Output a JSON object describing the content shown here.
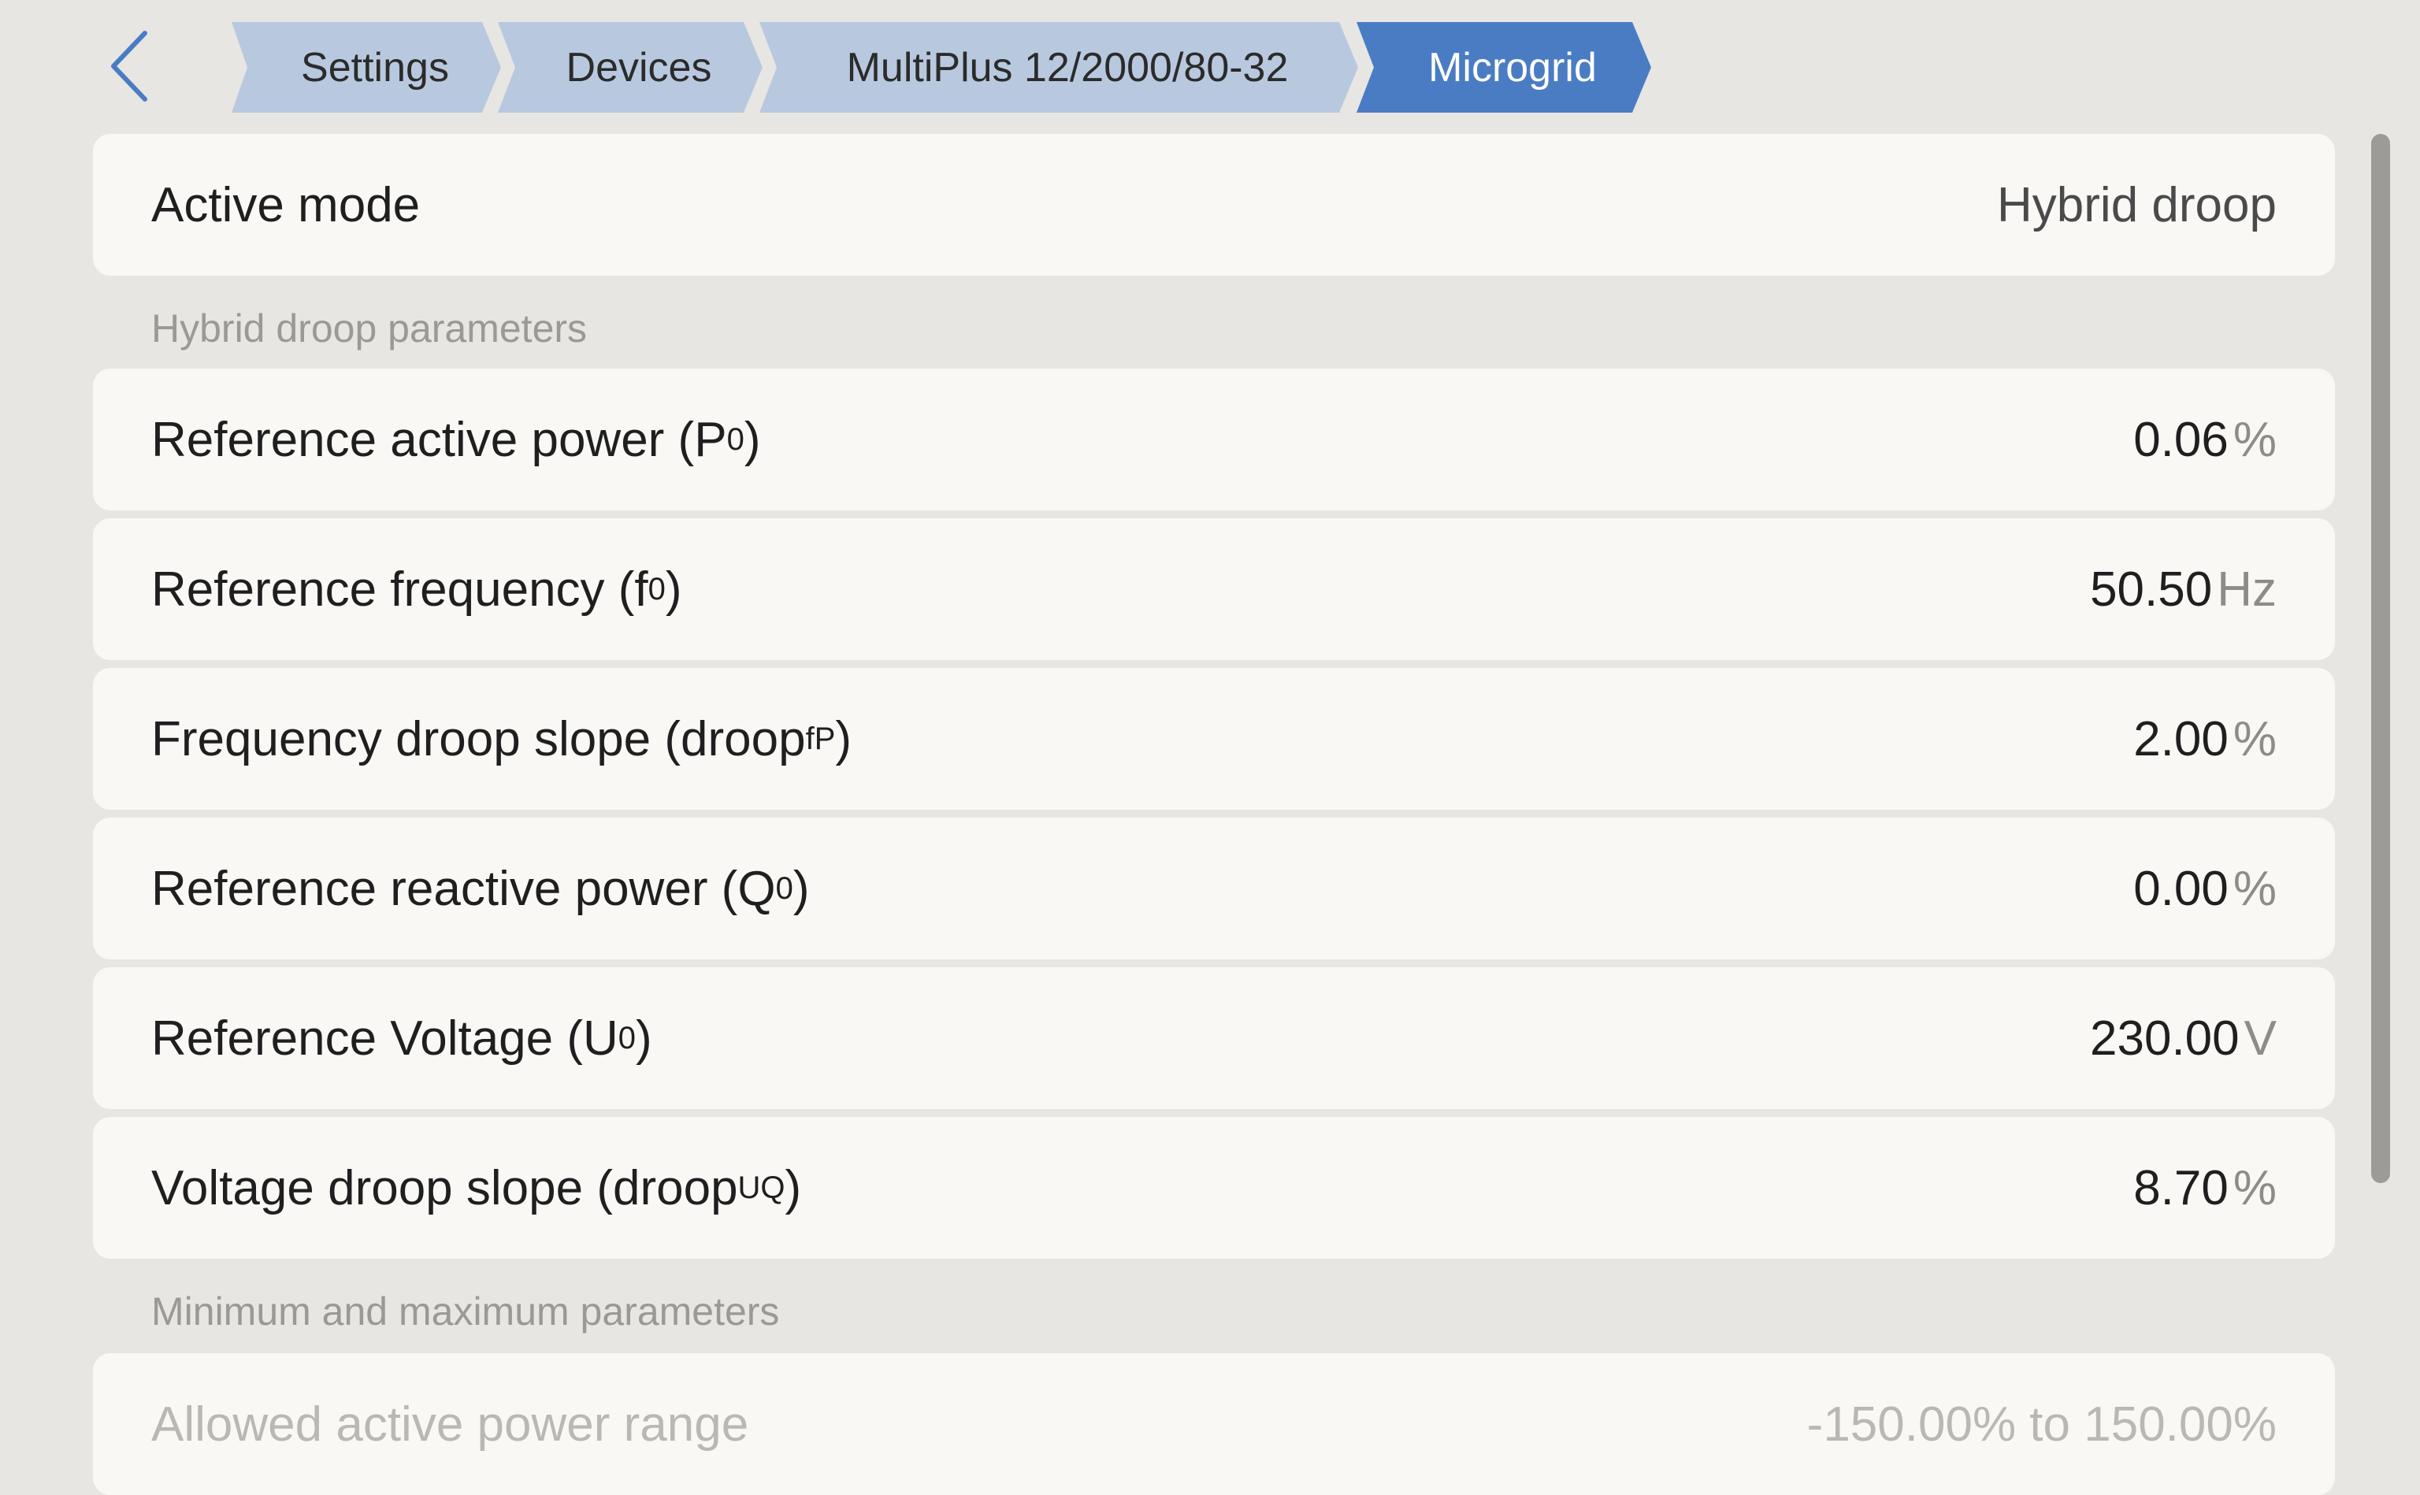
{
  "breadcrumb": {
    "items": [
      {
        "label": "Settings"
      },
      {
        "label": "Devices"
      },
      {
        "label": "MultiPlus 12/2000/80-32"
      },
      {
        "label": "Microgrid"
      }
    ]
  },
  "active_mode": {
    "label": "Active mode",
    "value": "Hybrid droop"
  },
  "sections": {
    "hybrid_title": "Hybrid droop parameters",
    "minmax_title": "Minimum and maximum parameters"
  },
  "params": [
    {
      "label_main": "Reference active power (P",
      "label_sub": "0",
      "label_end": ")",
      "value": "0.06",
      "unit": "%"
    },
    {
      "label_main": "Reference frequency (f",
      "label_sub": "0",
      "label_end": ")",
      "value": "50.50",
      "unit": "Hz"
    },
    {
      "label_main": "Frequency droop slope (droop",
      "label_sub": "fP",
      "label_end": ")",
      "value": "2.00",
      "unit": "%"
    },
    {
      "label_main": "Reference reactive power (Q",
      "label_sub": "0",
      "label_end": ")",
      "value": "0.00",
      "unit": "%"
    },
    {
      "label_main": "Reference Voltage (U",
      "label_sub": "0",
      "label_end": ")",
      "value": "230.00",
      "unit": "V"
    },
    {
      "label_main": "Voltage droop slope (droop",
      "label_sub": "UQ",
      "label_end": ")",
      "value": "8.70",
      "unit": "%"
    }
  ],
  "minmax": [
    {
      "label": "Allowed active power range",
      "value": "-150.00% to 150.00%"
    }
  ],
  "colors": {
    "background": "#e7e6e3",
    "row": "#f9f8f5",
    "crumb": "#b8c9df",
    "crumb_active": "#4a7cc4",
    "accent": "#4a7cc4"
  }
}
